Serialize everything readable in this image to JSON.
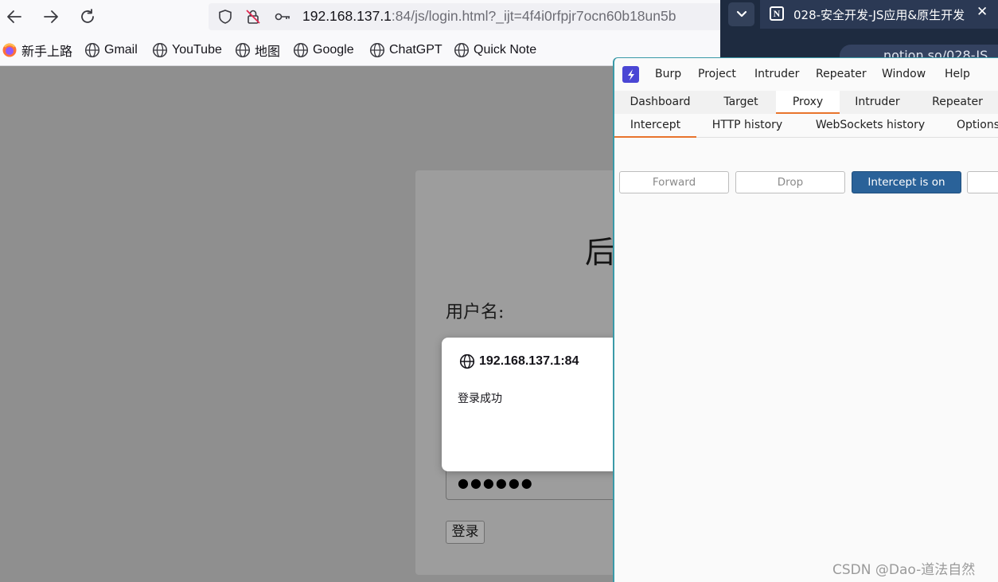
{
  "browser": {
    "url_host": "192.168.137.1",
    "url_rest": ":84/js/login.html?_ijt=4f4i0rfpjr7ocn60b18un5b",
    "bookmarks": [
      "新手上路",
      "Gmail",
      "YouTube",
      "地图",
      "Google",
      "ChatGPT",
      "Quick Note"
    ]
  },
  "page": {
    "title_partial": "后",
    "username_label": "用户名:",
    "password_mask": "●●●●●●",
    "login_button": "登录"
  },
  "alert": {
    "origin": "192.168.137.1:84",
    "message": "登录成功"
  },
  "second_window": {
    "tab_title": "028-安全开发-JS应用&原生开发",
    "url_partial": "notion.so/028-JS"
  },
  "burp": {
    "menu": [
      "Burp",
      "Project",
      "Intruder",
      "Repeater",
      "Window",
      "Help"
    ],
    "main_tabs": [
      {
        "label": "Dashboard",
        "active": false
      },
      {
        "label": "Target",
        "active": false
      },
      {
        "label": "Proxy",
        "active": true
      },
      {
        "label": "Intruder",
        "active": false
      },
      {
        "label": "Repeater",
        "active": false
      }
    ],
    "proxy_tabs": [
      {
        "label": "Intercept",
        "active": true
      },
      {
        "label": "HTTP history",
        "active": false
      },
      {
        "label": "WebSockets history",
        "active": false
      },
      {
        "label": "Options",
        "active": false
      }
    ],
    "buttons": {
      "forward": "Forward",
      "drop": "Drop",
      "intercept": "Intercept is on"
    },
    "accent_color": "#e8742c",
    "intercept_on_color": "#2a6299"
  },
  "watermark": "CSDN @Dao-道法自然"
}
